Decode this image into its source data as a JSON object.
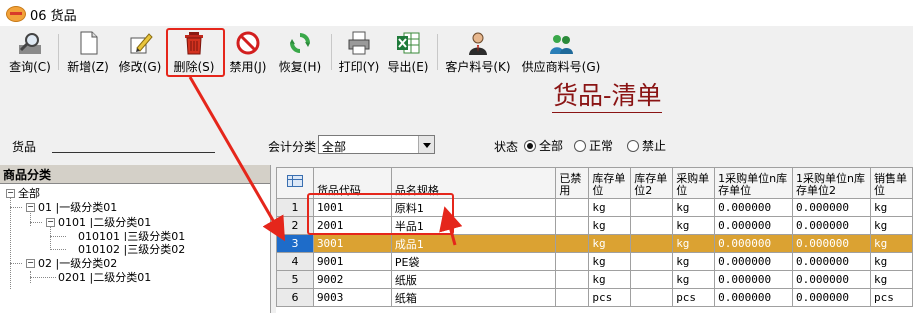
{
  "window": {
    "title": "06 货品"
  },
  "toolbar": {
    "buttons": [
      {
        "label": "查询(C)"
      },
      {
        "label": "新增(Z)"
      },
      {
        "label": "修改(G)"
      },
      {
        "label": "删除(S)"
      },
      {
        "label": "禁用(J)"
      },
      {
        "label": "恢复(H)"
      },
      {
        "label": "打印(Y)"
      },
      {
        "label": "导出(E)"
      },
      {
        "label": "客户料号(K)"
      },
      {
        "label": "供应商料号(G)"
      }
    ]
  },
  "doc_title": "货品-清单",
  "filters": {
    "goods_label": "货品",
    "account_label": "会计分类",
    "account_value": "全部",
    "status_label": "状态",
    "status_options": [
      "全部",
      "正常",
      "禁止"
    ],
    "status_selected": "全部"
  },
  "tree": {
    "header": "商品分类",
    "nodes": [
      "全部",
      "01 |一级分类01",
      "0101 |二级分类01",
      "010101 |三级分类01",
      "010102 |三级分类02",
      "02 |一级分类02",
      "0201 |二级分类01"
    ]
  },
  "grid": {
    "columns": [
      "",
      "货品代码",
      "品名规格",
      "已禁用",
      "库存单位",
      "库存单位2",
      "采购单位",
      "1采购单位n库存单位",
      "1采购单位n库存单位2",
      "销售单位"
    ],
    "rows": [
      [
        "1",
        "1001",
        "原料1",
        "",
        "kg",
        "",
        "kg",
        "0.000000",
        "0.000000",
        "kg"
      ],
      [
        "2",
        "2001",
        "半品1",
        "",
        "kg",
        "",
        "kg",
        "0.000000",
        "0.000000",
        "kg"
      ],
      [
        "3",
        "3001",
        "成品1",
        "",
        "kg",
        "",
        "kg",
        "0.000000",
        "0.000000",
        "kg"
      ],
      [
        "4",
        "9001",
        "PE袋",
        "",
        "kg",
        "",
        "kg",
        "0.000000",
        "0.000000",
        "kg"
      ],
      [
        "5",
        "9002",
        "纸版",
        "",
        "kg",
        "",
        "kg",
        "0.000000",
        "0.000000",
        "kg"
      ],
      [
        "6",
        "9003",
        "纸箱",
        "",
        "pcs",
        "",
        "pcs",
        "0.000000",
        "0.000000",
        "pcs"
      ]
    ],
    "selected_row": "3"
  },
  "colors": {
    "selected_row": "#dba232",
    "annotation": "#e5261b",
    "title": "#8a1414"
  },
  "icons": [
    "search-icon",
    "new-document-icon",
    "edit-icon",
    "trash-icon",
    "disable-icon",
    "restore-icon",
    "printer-icon",
    "excel-export-icon",
    "customer-icon",
    "supplier-icon"
  ]
}
